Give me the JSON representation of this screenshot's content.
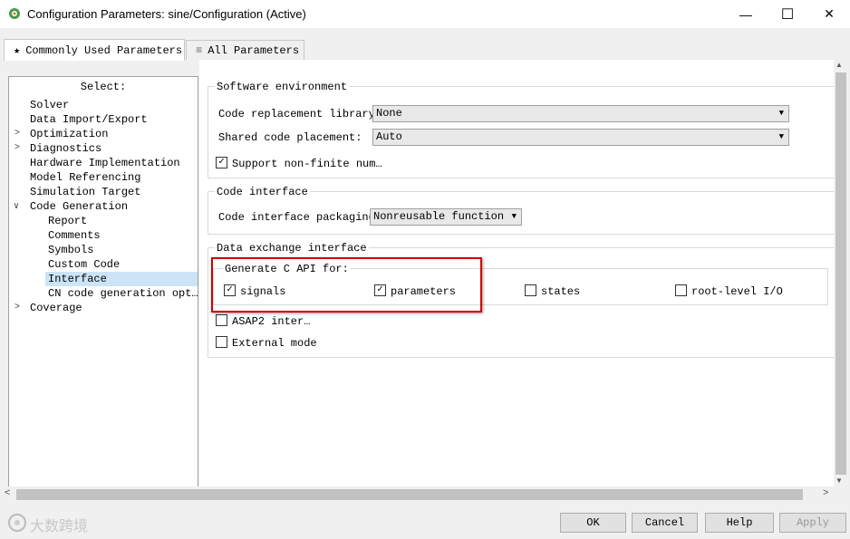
{
  "window": {
    "title": "Configuration Parameters: sine/Configuration (Active)",
    "minimize_glyph": "—",
    "maximize_glyph": "☐",
    "close_glyph": "✕"
  },
  "tabs": [
    {
      "label": "Commonly Used Parameters",
      "icon": "★",
      "active": true
    },
    {
      "label": "All Parameters",
      "icon": "≡",
      "active": false
    }
  ],
  "tree": {
    "header": "Select:",
    "items": [
      {
        "label": "Solver"
      },
      {
        "label": "Data Import/Export"
      },
      {
        "label": "Optimization"
      },
      {
        "label": "Diagnostics"
      },
      {
        "label": "Hardware Implementation"
      },
      {
        "label": "Model Referencing"
      },
      {
        "label": "Simulation Target"
      },
      {
        "label": "Code Generation"
      },
      {
        "label": "Report"
      },
      {
        "label": "Comments"
      },
      {
        "label": "Symbols"
      },
      {
        "label": "Custom Code"
      },
      {
        "label": "Interface"
      },
      {
        "label": "CN code generation opt…"
      },
      {
        "label": "Coverage"
      }
    ]
  },
  "software_env": {
    "legend": "Software environment",
    "code_replacement_label": "Code replacement library:",
    "code_replacement_value": "None",
    "shared_code_label": "Shared code placement:",
    "shared_code_value": "Auto",
    "nonfinite_label": "Support non-finite num…"
  },
  "code_interface": {
    "legend": "Code interface",
    "packaging_label": "Code interface packaging:",
    "packaging_value": "Nonreusable function"
  },
  "data_exchange": {
    "legend": "Data exchange interface",
    "capi_legend": "Generate C API for:",
    "signals": "signals",
    "parameters": "parameters",
    "states": "states",
    "root_io": "root-level I/O",
    "asap2": "ASAP2 inter…",
    "external_mode": "External mode"
  },
  "buttons": {
    "ok": "OK",
    "cancel": "Cancel",
    "help": "Help",
    "apply": "Apply"
  },
  "watermark": "大数跨境",
  "scroll": {
    "left_arrow": "<",
    "right_arrow": ">",
    "up_arrow": "▲",
    "down_arrow": "▼"
  }
}
